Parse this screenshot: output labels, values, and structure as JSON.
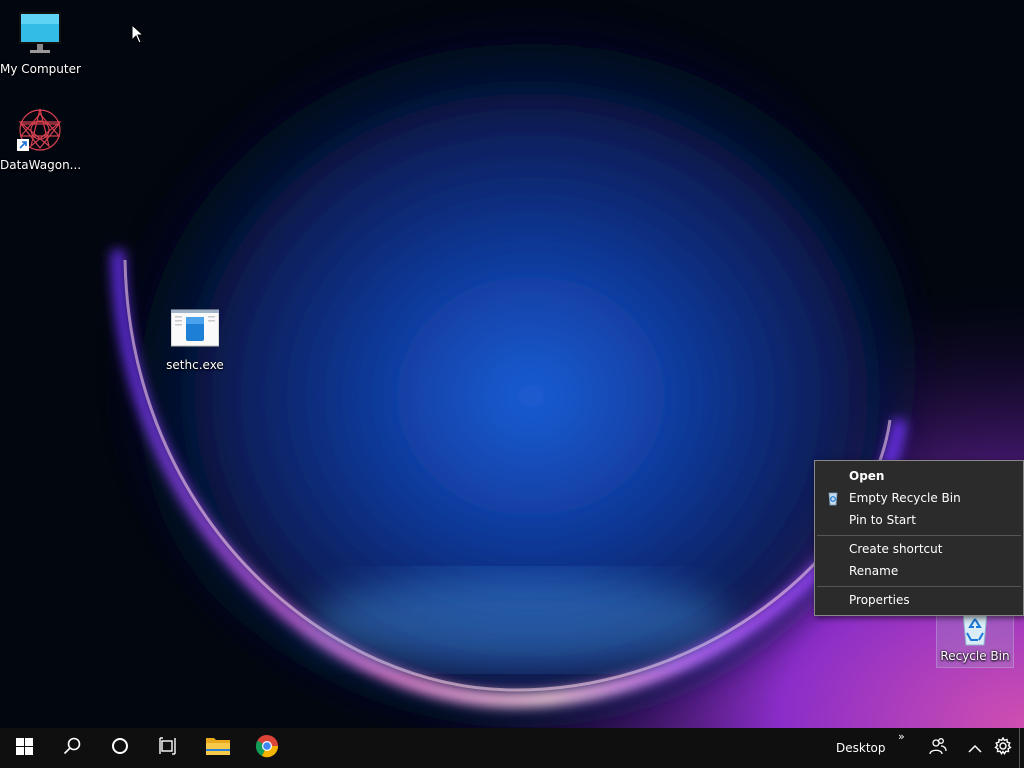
{
  "desktop": {
    "icons": [
      {
        "label": "My Computer"
      },
      {
        "label": "DataWagon..."
      },
      {
        "label": "sethc.exe"
      },
      {
        "label": "Recycle Bin"
      }
    ]
  },
  "context_menu": {
    "items": [
      {
        "label": "Open",
        "icon": "none",
        "bold": true
      },
      {
        "label": "Empty Recycle Bin",
        "icon": "recycle-bin-icon"
      },
      {
        "label": "Pin to Start"
      },
      {
        "label": "Create shortcut"
      },
      {
        "label": "Rename"
      },
      {
        "label": "Properties"
      }
    ]
  },
  "taskbar": {
    "toolbar_label": "Desktop",
    "overflow_glyph": "»",
    "icons": [
      "windows-start-icon",
      "search-icon",
      "cortana-icon",
      "task-view-icon",
      "file-explorer-icon",
      "chrome-icon",
      "people-icon",
      "chevron-up-icon",
      "gear-icon"
    ]
  },
  "colors": {
    "taskbar": "#0f0f0f",
    "menu_bg": "#2b2b2b",
    "wallpaper_glow": "#7a35ff"
  }
}
